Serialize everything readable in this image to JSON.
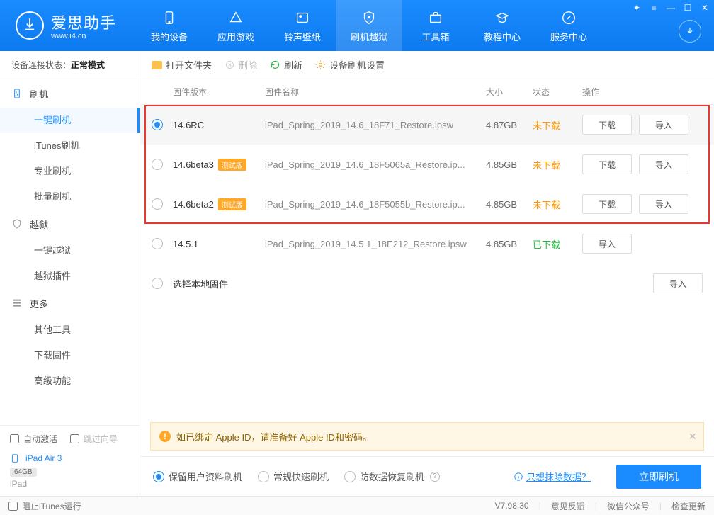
{
  "app": {
    "title": "爱思助手",
    "url": "www.i4.cn"
  },
  "nav": {
    "items": [
      {
        "label": "我的设备"
      },
      {
        "label": "应用游戏"
      },
      {
        "label": "铃声壁纸"
      },
      {
        "label": "刷机越狱"
      },
      {
        "label": "工具箱"
      },
      {
        "label": "教程中心"
      },
      {
        "label": "服务中心"
      }
    ]
  },
  "connection": {
    "label": "设备连接状态：",
    "value": "正常模式"
  },
  "sidebar": {
    "flash": {
      "title": "刷机",
      "items": [
        "一键刷机",
        "iTunes刷机",
        "专业刷机",
        "批量刷机"
      ]
    },
    "jailbreak": {
      "title": "越狱",
      "items": [
        "一键越狱",
        "越狱插件"
      ]
    },
    "more": {
      "title": "更多",
      "items": [
        "其他工具",
        "下载固件",
        "高级功能"
      ]
    },
    "auto_activate": "自动激活",
    "skip_guide": "跳过向导",
    "device_name": "iPad Air 3",
    "device_storage": "64GB",
    "device_type": "iPad"
  },
  "toolbar": {
    "open": "打开文件夹",
    "delete": "删除",
    "refresh": "刷新",
    "settings": "设备刷机设置"
  },
  "columns": {
    "version": "固件版本",
    "name": "固件名称",
    "size": "大小",
    "status": "状态",
    "ops": "操作"
  },
  "firmware": [
    {
      "version": "14.6RC",
      "beta": false,
      "name": "iPad_Spring_2019_14.6_18F71_Restore.ipsw",
      "size": "4.87GB",
      "status": "未下载",
      "downloaded": false,
      "selected": true
    },
    {
      "version": "14.6beta3",
      "beta": true,
      "name": "iPad_Spring_2019_14.6_18F5065a_Restore.ip...",
      "size": "4.85GB",
      "status": "未下载",
      "downloaded": false,
      "selected": false
    },
    {
      "version": "14.6beta2",
      "beta": true,
      "name": "iPad_Spring_2019_14.6_18F5055b_Restore.ip...",
      "size": "4.85GB",
      "status": "未下载",
      "downloaded": false,
      "selected": false
    },
    {
      "version": "14.5.1",
      "beta": false,
      "name": "iPad_Spring_2019_14.5.1_18E212_Restore.ipsw",
      "size": "4.85GB",
      "status": "已下载",
      "downloaded": true,
      "selected": false
    }
  ],
  "local_firmware": "选择本地固件",
  "beta_label": "测试版",
  "buttons": {
    "download": "下载",
    "import": "导入"
  },
  "alert": "如已绑定 Apple ID，请准备好 Apple ID和密码。",
  "flash_options": {
    "keep": "保留用户资料刷机",
    "normal": "常规快速刷机",
    "recover": "防数据恢复刷机"
  },
  "erase_link": "只想抹除数据？",
  "flash_now": "立即刷机",
  "statusbar": {
    "block_itunes": "阻止iTunes运行",
    "version": "V7.98.30",
    "feedback": "意见反馈",
    "wechat": "微信公众号",
    "update": "检查更新"
  }
}
